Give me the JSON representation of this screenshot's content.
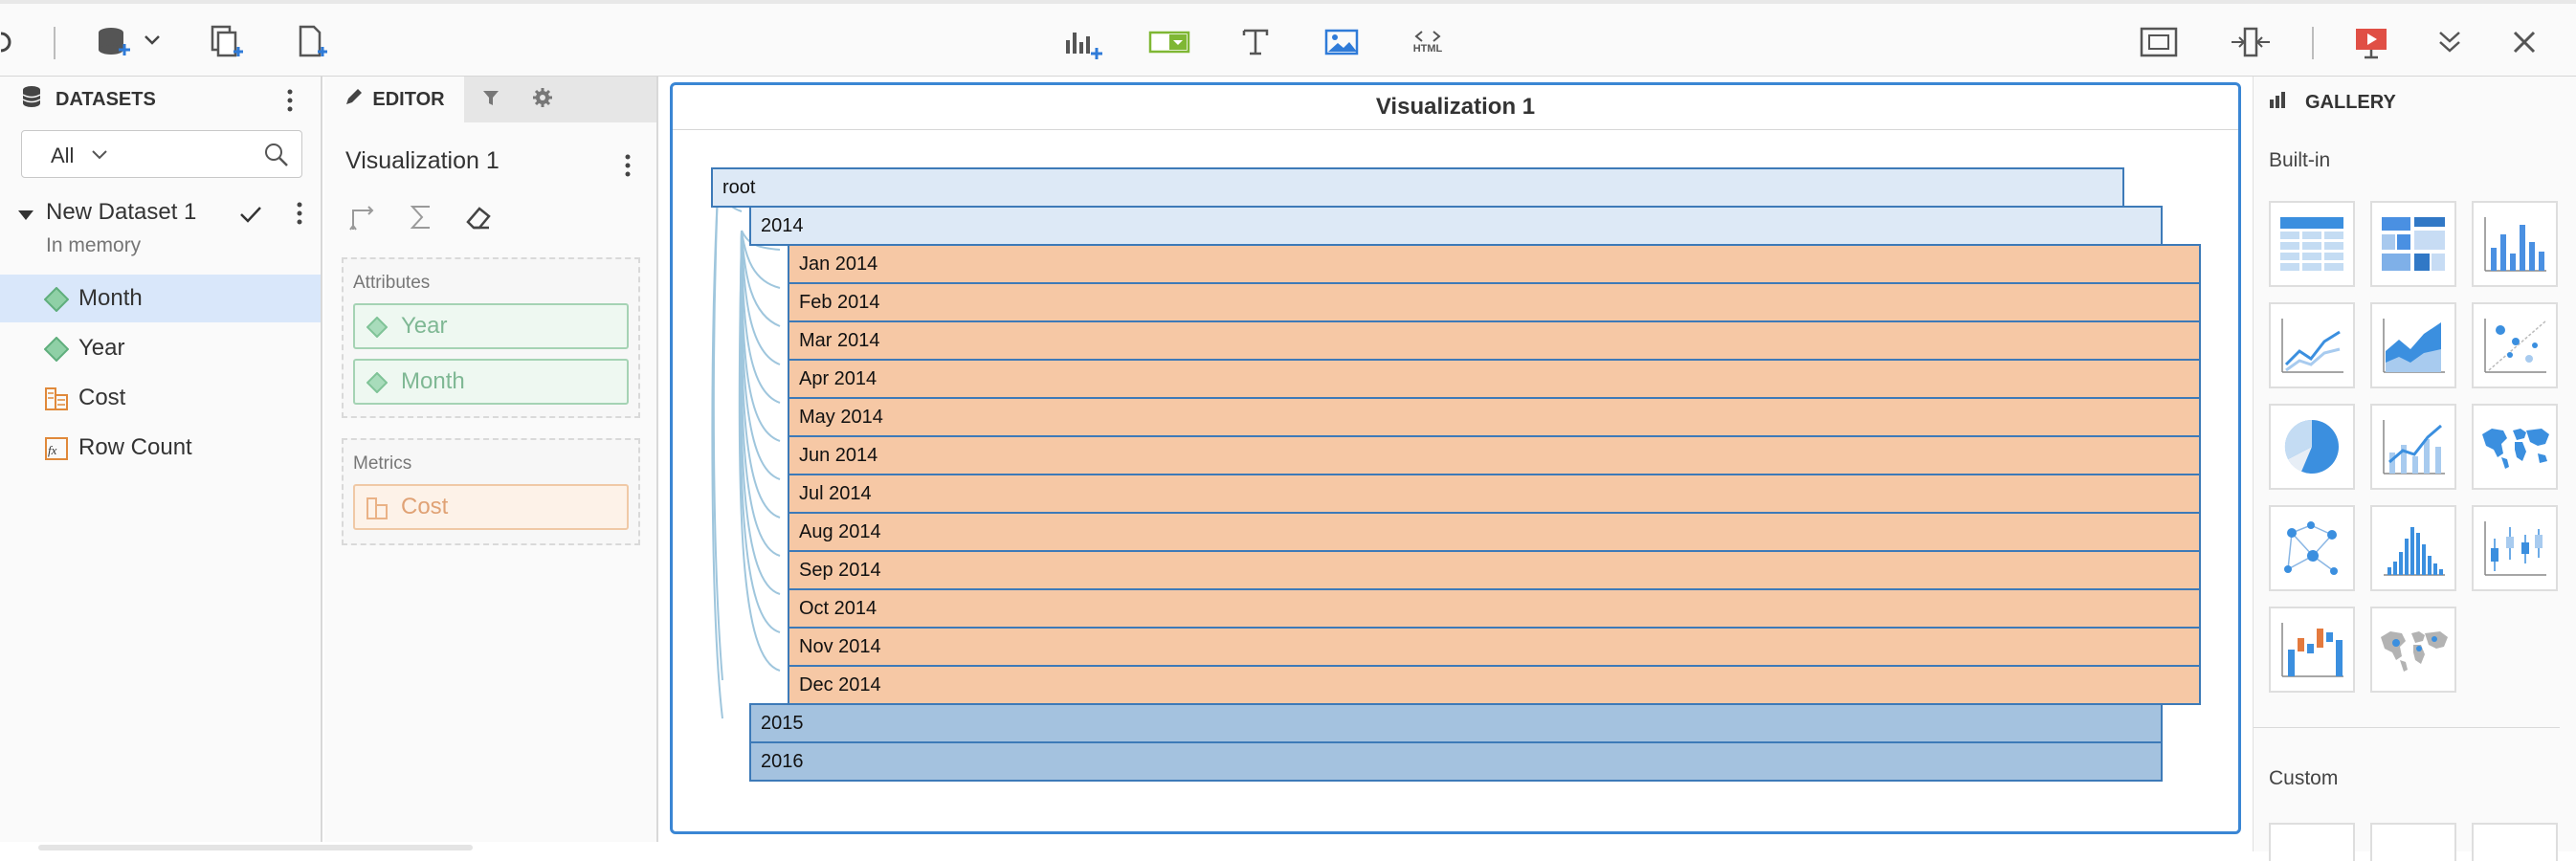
{
  "toolbar": {
    "left_icons": [
      "dataset-add-icon",
      "duplicate-page-icon",
      "new-page-icon"
    ],
    "center_icons": [
      "insert-chart-icon",
      "insert-filter-icon",
      "insert-text-icon",
      "insert-image-icon",
      "insert-html-icon"
    ],
    "html_label": "HTML",
    "right_icons": [
      "fit-page-icon",
      "fit-width-icon",
      "presentation-icon",
      "collapse-icon",
      "close-icon"
    ]
  },
  "datasets_panel": {
    "title": "DATASETS",
    "filter_value": "All",
    "dataset": {
      "name": "New Dataset 1",
      "status": "In memory"
    },
    "items": [
      {
        "label": "Month",
        "icon": "attribute-icon",
        "selected": true
      },
      {
        "label": "Year",
        "icon": "attribute-icon",
        "selected": false
      },
      {
        "label": "Cost",
        "icon": "metric-icon",
        "selected": false
      },
      {
        "label": "Row Count",
        "icon": "derived-metric-icon",
        "selected": false
      }
    ]
  },
  "editor_panel": {
    "tab_label": "EDITOR",
    "viz_name": "Visualization 1",
    "attributes_title": "Attributes",
    "attributes": [
      "Year",
      "Month"
    ],
    "metrics_title": "Metrics",
    "metrics": [
      "Cost"
    ]
  },
  "canvas": {
    "viz_title": "Visualization 1",
    "tree": {
      "root": "root",
      "year_2014": "2014",
      "months_2014": [
        "Jan 2014",
        "Feb 2014",
        "Mar 2014",
        "Apr 2014",
        "May 2014",
        "Jun 2014",
        "Jul 2014",
        "Aug 2014",
        "Sep 2014",
        "Oct 2014",
        "Nov 2014",
        "Dec 2014"
      ],
      "year_2015": "2015",
      "year_2016": "2016"
    },
    "colors": {
      "branch": "#dde9f6",
      "leaf": "#f6c8a5",
      "collapsed": "#a4c2df",
      "border": "#3d7ab8"
    }
  },
  "gallery": {
    "title": "GALLERY",
    "builtin_label": "Built-in",
    "custom_label": "Custom",
    "tiles": [
      "grid-icon",
      "heatmap-icon",
      "bar-chart-icon",
      "line-chart-icon",
      "area-chart-icon",
      "scatter-icon",
      "pie-chart-icon",
      "combo-chart-icon",
      "map-icon",
      "network-icon",
      "histogram-icon",
      "boxplot-icon",
      "waterfall-icon",
      "geo-map-icon"
    ]
  }
}
